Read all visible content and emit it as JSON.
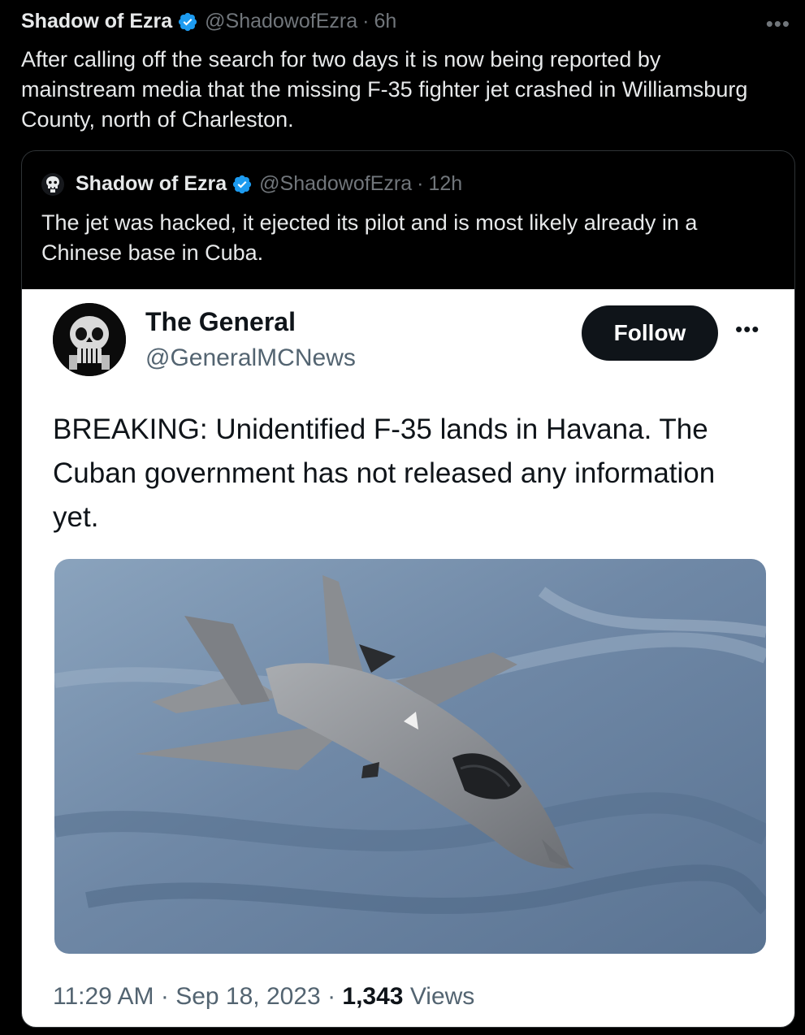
{
  "post": {
    "author_name": "Shadow of Ezra",
    "handle": "@ShadowofEzra",
    "separator": "·",
    "time": "6h",
    "more_icon": "more-horizontal-icon",
    "text": "After calling off the search for two days it is now being reported by mainstream media that the missing F-35 fighter jet crashed in Williamsburg County, north of Charleston."
  },
  "quoted": {
    "author_name": "Shadow of Ezra",
    "handle": "@ShadowofEzra",
    "separator": "·",
    "time": "12h",
    "text": "The jet was hacked, it ejected its pilot and is most likely already in a Chinese base in Cuba.",
    "embedded": {
      "author_name": "The General",
      "handle": "@GeneralMCNews",
      "follow_label": "Follow",
      "text": "BREAKING: Unidentified F-35 lands in Havana. The Cuban government has not released any information yet.",
      "time": "11:29 AM",
      "dot1": "·",
      "date": "Sep 18, 2023",
      "dot2": "·",
      "views_count": "1,343",
      "views_label": "Views"
    }
  },
  "colors": {
    "background": "#000000",
    "verified_badge": "#1d9bf0",
    "muted_text": "#71767b",
    "card_background": "#ffffff",
    "follow_button": "#0f1419"
  }
}
